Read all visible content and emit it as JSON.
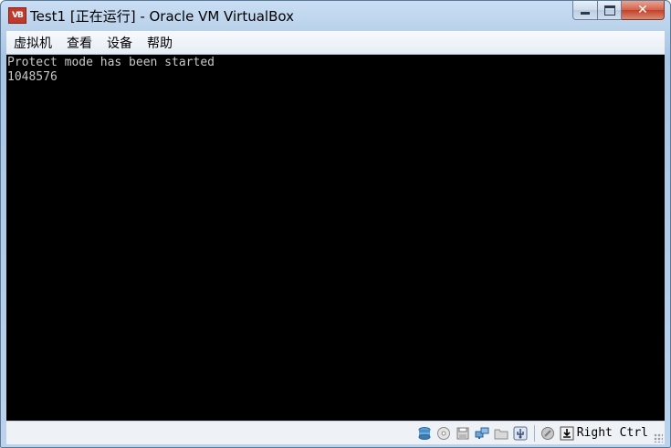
{
  "window": {
    "title": "Test1 [正在运行] - Oracle VM VirtualBox",
    "app_icon_text": "VB"
  },
  "menubar": {
    "items": [
      {
        "label": "虚拟机"
      },
      {
        "label": "查看"
      },
      {
        "label": "设备"
      },
      {
        "label": "帮助"
      }
    ]
  },
  "console": {
    "lines": [
      "Protect mode has been started",
      "1048576"
    ]
  },
  "statusbar": {
    "icons": [
      "hard-disk-icon",
      "optical-drive-icon",
      "floppy-icon",
      "network-icon",
      "shared-folder-icon",
      "usb-icon",
      "capture-icon",
      "host-key-icon"
    ],
    "host_key_label": "Right Ctrl"
  },
  "colors": {
    "screen_background": "#000000",
    "console_text": "#c8c8c8",
    "close_button": "#c4402a"
  }
}
